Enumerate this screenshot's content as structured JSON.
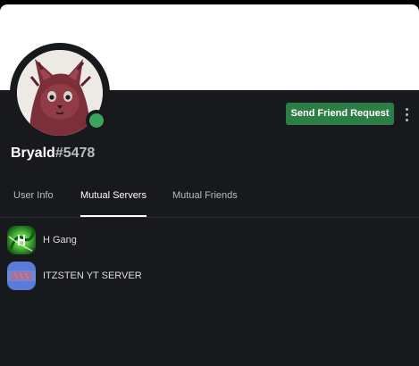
{
  "profile": {
    "username": "Bryald",
    "discriminator": "#5478",
    "status": "online",
    "avatar_icon": "cat-avatar-icon",
    "banner_color": "#ffffff"
  },
  "actions": {
    "send_friend_request_label": "Send Friend Request",
    "more_icon": "more-vertical-icon"
  },
  "tabs": [
    {
      "label": "User Info",
      "active": false
    },
    {
      "label": "Mutual Servers",
      "active": true
    },
    {
      "label": "Mutual Friends",
      "active": false
    }
  ],
  "mutual_servers": [
    {
      "name": "H Gang",
      "icon": "h-gang-server-icon"
    },
    {
      "name": "ITZSTEN YT SERVER",
      "icon": "itzsten-server-icon"
    }
  ],
  "colors": {
    "background": "#18191c",
    "accent_green": "#2d7d46",
    "online_status": "#3ba55d",
    "tab_divider": "#2f3136",
    "muted_text": "#b9bbbe"
  }
}
